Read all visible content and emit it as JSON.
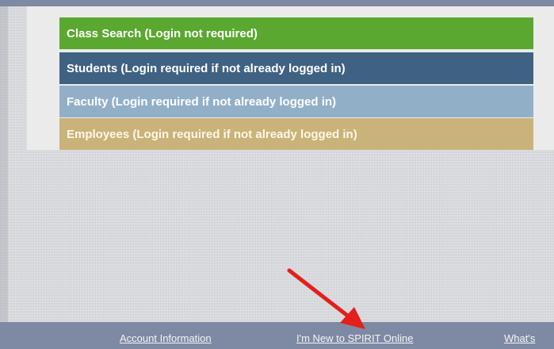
{
  "menu": {
    "items": [
      {
        "label": "Class Search (Login not required)",
        "color": "#5aa830"
      },
      {
        "label": "Students (Login required if not already logged in)",
        "color": "#3f6283"
      },
      {
        "label": "Faculty (Login required if not already logged in)",
        "color": "#92afc8"
      },
      {
        "label": "Employees (Login required if not already logged in)",
        "color": "#c9b37a"
      }
    ]
  },
  "footer": {
    "links": [
      {
        "label": "Account Information"
      },
      {
        "label": "I'm New to SPIRIT Online"
      },
      {
        "label": "What's"
      }
    ]
  },
  "annotation": {
    "arrow_color": "#e3201b",
    "arrow_icon": "red-arrow-icon"
  }
}
